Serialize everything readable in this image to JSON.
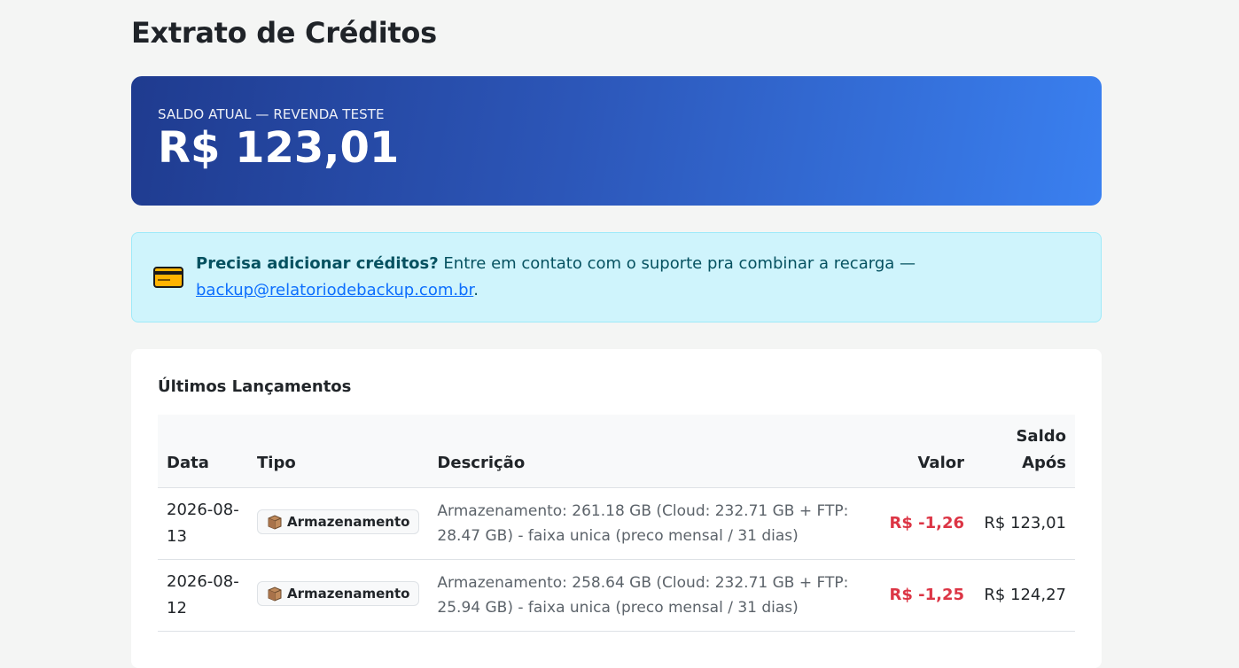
{
  "page": {
    "title": "Extrato de Créditos"
  },
  "balance": {
    "label": "SALDO ATUAL — REVENDA TESTE",
    "value": "R$ 123,01"
  },
  "info": {
    "bold": "Precisa adicionar créditos?",
    "text": " Entre em contato com o suporte pra combinar a recarga — ",
    "email": "backup@relatoriodebackup.com.br",
    "suffix": "."
  },
  "launches": {
    "title": "Últimos Lançamentos",
    "columns": {
      "data": "Data",
      "tipo": "Tipo",
      "descricao": "Descrição",
      "valor": "Valor",
      "saldo": "Saldo Após"
    },
    "rows": [
      {
        "data": "2026-08-13",
        "tipo": "Armazenamento",
        "descricao": "Armazenamento: 261.18 GB (Cloud: 232.71 GB + FTP: 28.47 GB) - faixa unica (preco mensal / 31 dias)",
        "valor": "R$ -1,26",
        "saldo": "R$ 123,01"
      },
      {
        "data": "2026-08-12",
        "tipo": "Armazenamento",
        "descricao": "Armazenamento: 258.64 GB (Cloud: 232.71 GB + FTP: 25.94 GB) - faixa unica (preco mensal / 31 dias)",
        "valor": "R$ -1,25",
        "saldo": "R$ 124,27"
      }
    ]
  },
  "icons": {
    "info": "credit-card-icon",
    "tipo": "package-icon"
  },
  "colors": {
    "negative": "#dc3545",
    "gradient_start": "#1f3b8f",
    "gradient_end": "#3a80f0",
    "info_bg": "#cff4fc"
  }
}
